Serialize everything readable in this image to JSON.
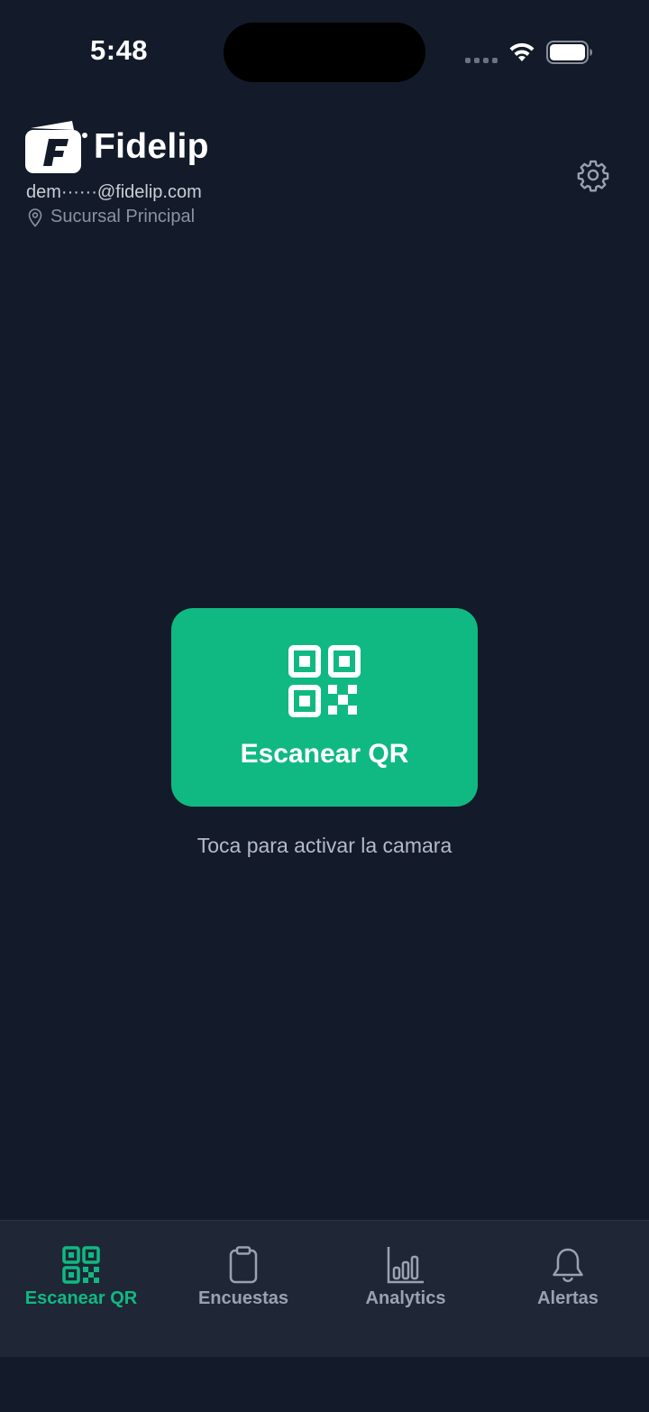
{
  "status_bar": {
    "time": "5:48"
  },
  "header": {
    "brand": "Fidelip",
    "email": "dem······@fidelip.com",
    "branch": "Sucursal Principal"
  },
  "main": {
    "scan_button_label": "Escanear QR",
    "hint": "Toca para activar la camara"
  },
  "tabs": [
    {
      "label": "Escanear QR",
      "icon": "qr-code-icon",
      "active": true
    },
    {
      "label": "Encuestas",
      "icon": "clipboard-icon",
      "active": false
    },
    {
      "label": "Analytics",
      "icon": "bar-chart-icon",
      "active": false
    },
    {
      "label": "Alertas",
      "icon": "bell-icon",
      "active": false
    }
  ],
  "colors": {
    "background": "#131a29",
    "accent": "#10b981",
    "tab_bar": "#1f2737",
    "muted_text": "#9aa2b1"
  }
}
